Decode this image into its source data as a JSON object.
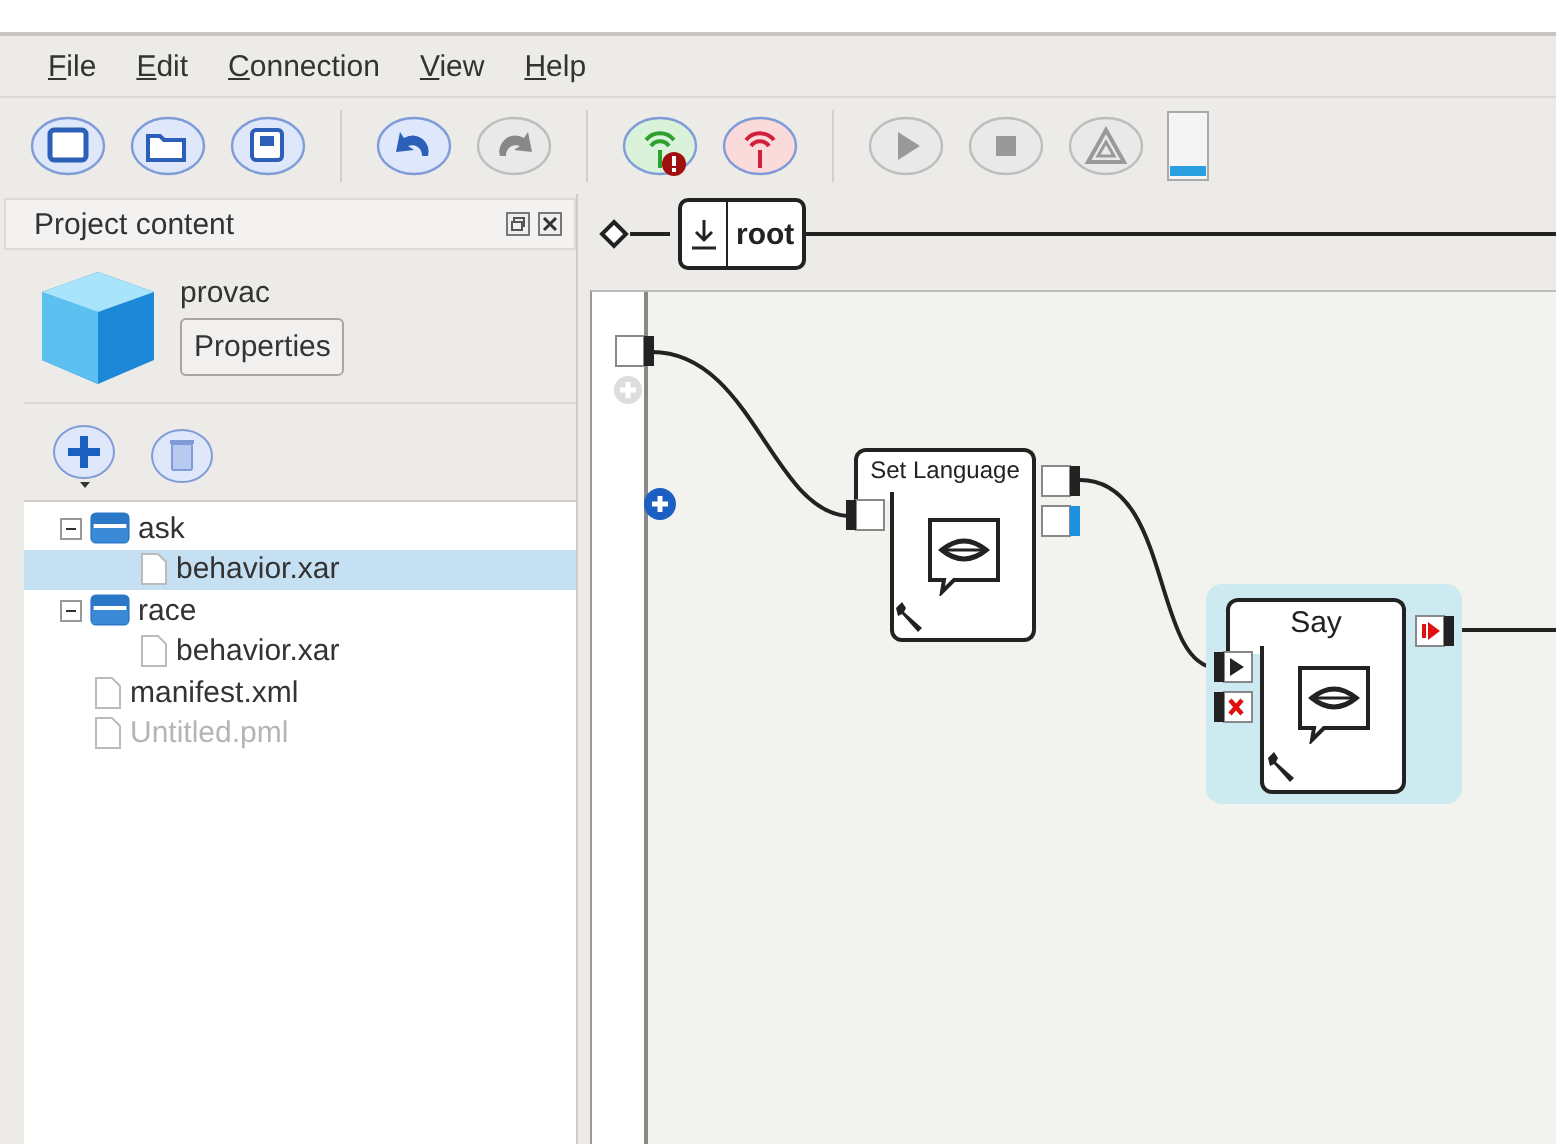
{
  "menu": [
    {
      "label": "File"
    },
    {
      "label": "Edit"
    },
    {
      "label": "Connection"
    },
    {
      "label": "View"
    },
    {
      "label": "Help"
    }
  ],
  "toolbar": [
    {
      "kind": "new",
      "disabled": false
    },
    {
      "kind": "open",
      "disabled": false
    },
    {
      "kind": "save",
      "disabled": false
    },
    {
      "kind": "separator"
    },
    {
      "kind": "undo",
      "disabled": false
    },
    {
      "kind": "redo",
      "disabled": true
    },
    {
      "kind": "separator"
    },
    {
      "kind": "connect",
      "disabled": false
    },
    {
      "kind": "disconnect",
      "disabled": false
    },
    {
      "kind": "separator"
    },
    {
      "kind": "play",
      "disabled": true
    },
    {
      "kind": "stop",
      "disabled": true
    },
    {
      "kind": "warning",
      "disabled": true
    },
    {
      "kind": "battery"
    }
  ],
  "project_panel": {
    "title": "Project content",
    "project_name": "provac",
    "properties_button": "Properties",
    "tree": [
      {
        "kind": "folder",
        "label": "ask",
        "expanded": true,
        "selected": false,
        "dimmed": false,
        "children": [
          {
            "kind": "file",
            "label": "behavior.xar",
            "selected": true,
            "dimmed": false
          }
        ]
      },
      {
        "kind": "folder",
        "label": "race",
        "expanded": true,
        "selected": false,
        "dimmed": false,
        "children": [
          {
            "kind": "file",
            "label": "behavior.xar",
            "selected": false,
            "dimmed": false
          }
        ]
      },
      {
        "kind": "file",
        "label": "manifest.xml",
        "selected": false,
        "dimmed": false
      },
      {
        "kind": "file",
        "label": "Untitled.pml",
        "selected": false,
        "dimmed": true
      }
    ]
  },
  "breadcrumb": {
    "label": "root"
  },
  "diagram": {
    "boxes": [
      {
        "title": "Set Language",
        "selected": false
      },
      {
        "title": "Say",
        "selected": true
      }
    ]
  }
}
